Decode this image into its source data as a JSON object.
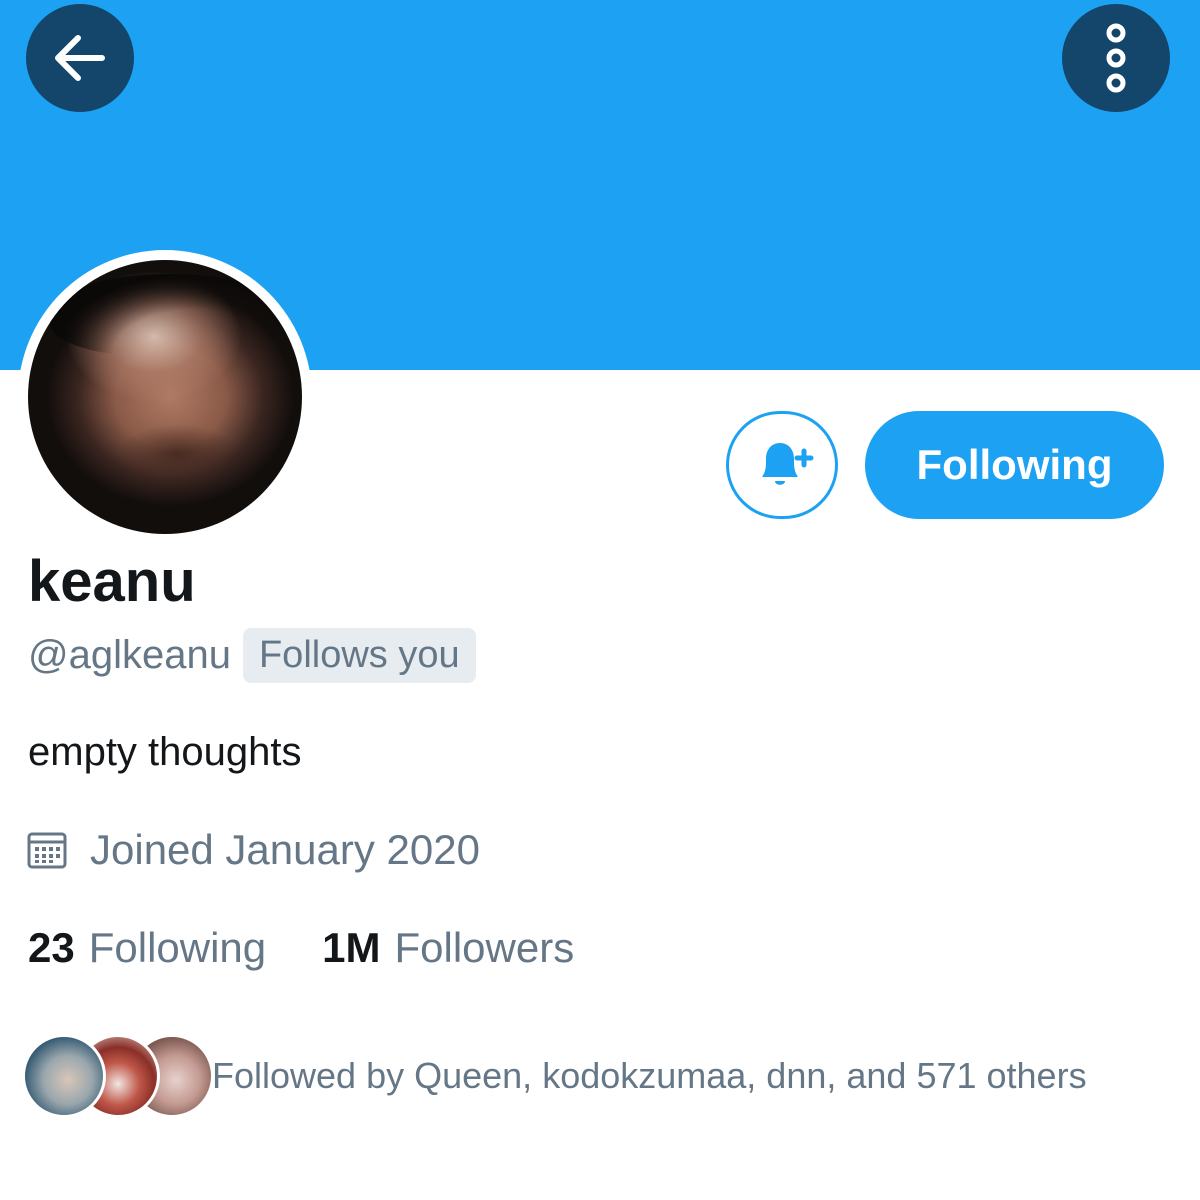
{
  "header": {
    "back_icon": "arrow-left-icon",
    "more_icon": "more-vertical-icon",
    "banner_color": "#1da1f2"
  },
  "profile": {
    "display_name": "keanu",
    "handle": "@aglkeanu",
    "follows_you_badge": "Follows you",
    "bio": "empty thoughts",
    "joined": "Joined January 2020"
  },
  "actions": {
    "notify_icon": "bell-plus-icon",
    "follow_button_label": "Following"
  },
  "stats": {
    "following_count": "23",
    "following_label": "Following",
    "followers_count": "1M",
    "followers_label": "Followers"
  },
  "followed_by": {
    "text": "Followed by Queen, kodokzumaa, dnn, and 571 others"
  },
  "colors": {
    "accent": "#1da1f2",
    "dark_button": "#13466a",
    "muted_text": "#657786",
    "primary_text": "#14171a"
  }
}
